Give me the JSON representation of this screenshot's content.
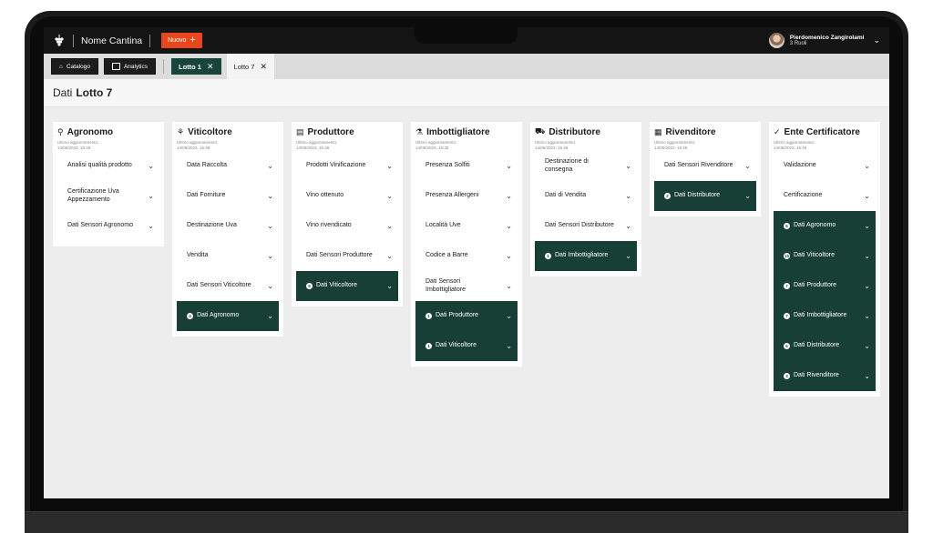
{
  "topbar": {
    "brand": "Nome Cantina",
    "new_label": "Nuovo",
    "user_name": "Pierdomenico Zangirolami",
    "user_role": "3 Ruoli"
  },
  "tabs": {
    "catalog": "Catalogo",
    "analytics": "Analytics",
    "lot1": "Lotto 1",
    "lot7": "Lotto 7"
  },
  "page": {
    "prefix": "Dati",
    "title": "Lotto 7"
  },
  "columns": [
    {
      "title": "Agronomo",
      "icon": "agronomo-icon",
      "sub1": "Ultimo aggiornamento:",
      "sub2": "14/06/2023, 15:48",
      "items": [
        {
          "label": "Analisi qualità prodotto"
        },
        {
          "label": "Certificazione Uva Appezzamento"
        },
        {
          "label": "Dati Sensori Agronomo"
        }
      ]
    },
    {
      "title": "Viticoltore",
      "icon": "viticoltore-icon",
      "sub1": "Ultimo aggiornamento:",
      "sub2": "14/06/2023, 15:48",
      "items": [
        {
          "label": "Data Raccolta"
        },
        {
          "label": "Dati Forniture"
        },
        {
          "label": "Destinazione Uva"
        },
        {
          "label": "Vendita"
        },
        {
          "label": "Dati Sensori Viticoltore"
        },
        {
          "label": "Dati Agronomo",
          "badge": "4",
          "dark": true
        }
      ]
    },
    {
      "title": "Produttore",
      "icon": "produttore-icon",
      "sub1": "Ultimo aggiornamento:",
      "sub2": "14/06/2023, 15:48",
      "items": [
        {
          "label": "Prodotti Vinificazione"
        },
        {
          "label": "Vino ottenuto"
        },
        {
          "label": "Vino rivendicato"
        },
        {
          "label": "Dati Sensori Produttore"
        },
        {
          "label": "Dati Viticoltore",
          "badge": "5",
          "dark": true
        }
      ]
    },
    {
      "title": "Imbottigliatore",
      "icon": "imbottigliatore-icon",
      "sub1": "Ultimo aggiornamento:",
      "sub2": "14/06/2023, 15:48",
      "items": [
        {
          "label": "Presenza Solfiti"
        },
        {
          "label": "Presenza Allergeni"
        },
        {
          "label": "Località Uve"
        },
        {
          "label": "Codice a Barre"
        },
        {
          "label": "Dati Sensori Imbottigliatore"
        },
        {
          "label": "Dati Produttore",
          "badge": "1",
          "dark": true
        },
        {
          "label": "Dati Viticoltore",
          "badge": "1",
          "dark": true
        }
      ]
    },
    {
      "title": "Distributore",
      "icon": "distributore-icon",
      "sub1": "Ultimo aggiornamento:",
      "sub2": "14/06/2023, 15:48",
      "items": [
        {
          "label": "Destinazione di consegna"
        },
        {
          "label": "Dati di Vendita"
        },
        {
          "label": "Dati Sensori Distributore"
        },
        {
          "label": "Dati Imbottigliatore",
          "badge": "1",
          "dark": true
        }
      ]
    },
    {
      "title": "Rivenditore",
      "icon": "rivenditore-icon",
      "sub1": "Ultimo aggiornamento:",
      "sub2": "14/06/2023, 15:48",
      "items": [
        {
          "label": "Dati Sensori Rivenditore"
        },
        {
          "label": "Dati Distributore",
          "badge": "2",
          "dark": true
        }
      ]
    },
    {
      "title": "Ente Certificatore",
      "icon": "ente-certificatore-icon",
      "sub1": "Ultimo aggiornamento:",
      "sub2": "14/06/2023, 15:48",
      "items": [
        {
          "label": "Validazione"
        },
        {
          "label": "Certificazione"
        },
        {
          "label": "Dati Agronomo",
          "badge": "6",
          "dark": true
        },
        {
          "label": "Dati Viticoltore",
          "badge": "15",
          "dark": true
        },
        {
          "label": "Dati Produttore",
          "badge": "7",
          "dark": true
        },
        {
          "label": "Dati Imbottigliatore",
          "badge": "7",
          "dark": true
        },
        {
          "label": "Dati Distributore",
          "badge": "6",
          "dark": true
        },
        {
          "label": "Dati Rivenditore",
          "badge": "3",
          "dark": true
        }
      ]
    }
  ],
  "colors": {
    "accent": "#e8471c",
    "dark_green": "#183f36"
  }
}
